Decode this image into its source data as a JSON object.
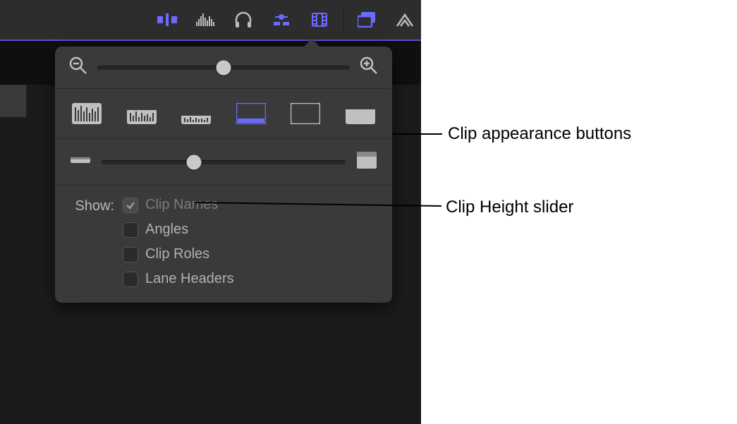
{
  "toolbar": {
    "icons": [
      "trim-icon",
      "audio-icon",
      "headphones-icon",
      "snap-icon",
      "clip-appearance-icon",
      "card-icon",
      "loop-icon"
    ],
    "active_icon": "clip-appearance-icon"
  },
  "popover": {
    "zoom": {
      "value_percent": 50
    },
    "appearance_buttons": [
      {
        "name": "filmstrip-waveform-tall",
        "active": false
      },
      {
        "name": "filmstrip-waveform",
        "active": false
      },
      {
        "name": "filmstrip-waveform-short",
        "active": false
      },
      {
        "name": "waveform-only",
        "active": true
      },
      {
        "name": "filmstrip-only",
        "active": false
      },
      {
        "name": "solid-only",
        "active": false
      }
    ],
    "clip_height": {
      "value_percent": 38
    },
    "show": {
      "label": "Show:",
      "options": [
        {
          "label": "Clip Names",
          "checked": true,
          "disabled": true
        },
        {
          "label": "Angles",
          "checked": false,
          "disabled": false
        },
        {
          "label": "Clip Roles",
          "checked": false,
          "disabled": false
        },
        {
          "label": "Lane Headers",
          "checked": false,
          "disabled": false
        }
      ]
    }
  },
  "annotations": {
    "appearance": "Clip appearance buttons",
    "height": "Clip Height slider"
  },
  "colors": {
    "accent": "#6b6bff",
    "panel": "#3a3a3a",
    "toolbar": "#2d2d2d"
  }
}
